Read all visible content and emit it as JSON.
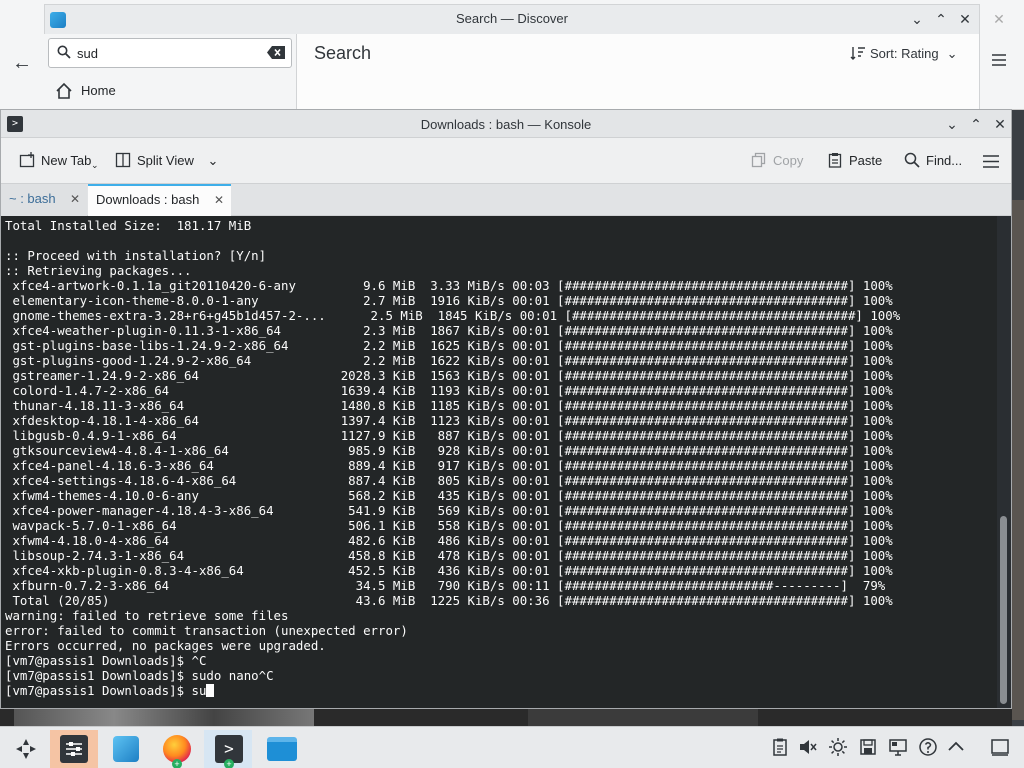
{
  "discover": {
    "title": "Search — Discover",
    "search_value": "sud",
    "home_label": "Home",
    "page_title": "Search",
    "sort_label": "Sort: Rating"
  },
  "konsole": {
    "title": "Downloads : bash — Konsole",
    "toolbar": {
      "new_tab": "New Tab",
      "split_view": "Split View",
      "copy": "Copy",
      "paste": "Paste",
      "find": "Find..."
    },
    "tabs": [
      {
        "label": "~ : bash",
        "active": false
      },
      {
        "label": "Downloads : bash",
        "active": true
      }
    ],
    "terminal_lines": [
      "Total Installed Size:  181.17 MiB",
      "",
      ":: Proceed with installation? [Y/n]",
      ":: Retrieving packages...",
      " xfce4-artwork-0.1.1a_git20110420-6-any         9.6 MiB  3.33 MiB/s 00:03 [######################################] 100%",
      " elementary-icon-theme-8.0.0-1-any              2.7 MiB  1916 KiB/s 00:01 [######################################] 100%",
      " gnome-themes-extra-3.28+r6+g45b1d457-2-...      2.5 MiB  1845 KiB/s 00:01 [######################################] 100%",
      " xfce4-weather-plugin-0.11.3-1-x86_64           2.3 MiB  1867 KiB/s 00:01 [######################################] 100%",
      " gst-plugins-base-libs-1.24.9-2-x86_64          2.2 MiB  1625 KiB/s 00:01 [######################################] 100%",
      " gst-plugins-good-1.24.9-2-x86_64               2.2 MiB  1622 KiB/s 00:01 [######################################] 100%",
      " gstreamer-1.24.9-2-x86_64                   2028.3 KiB  1563 KiB/s 00:01 [######################################] 100%",
      " colord-1.4.7-2-x86_64                       1639.4 KiB  1193 KiB/s 00:01 [######################################] 100%",
      " thunar-4.18.11-3-x86_64                     1480.8 KiB  1185 KiB/s 00:01 [######################################] 100%",
      " xfdesktop-4.18.1-4-x86_64                   1397.4 KiB  1123 KiB/s 00:01 [######################################] 100%",
      " libgusb-0.4.9-1-x86_64                      1127.9 KiB   887 KiB/s 00:01 [######################################] 100%",
      " gtksourceview4-4.8.4-1-x86_64                985.9 KiB   928 KiB/s 00:01 [######################################] 100%",
      " xfce4-panel-4.18.6-3-x86_64                  889.4 KiB   917 KiB/s 00:01 [######################################] 100%",
      " xfce4-settings-4.18.6-4-x86_64               887.4 KiB   805 KiB/s 00:01 [######################################] 100%",
      " xfwm4-themes-4.10.0-6-any                    568.2 KiB   435 KiB/s 00:01 [######################################] 100%",
      " xfce4-power-manager-4.18.4-3-x86_64          541.9 KiB   569 KiB/s 00:01 [######################################] 100%",
      " wavpack-5.7.0-1-x86_64                       506.1 KiB   558 KiB/s 00:01 [######################################] 100%",
      " xfwm4-4.18.0-4-x86_64                        482.6 KiB   486 KiB/s 00:01 [######################################] 100%",
      " libsoup-2.74.3-1-x86_64                      458.8 KiB   478 KiB/s 00:01 [######################################] 100%",
      " xfce4-xkb-plugin-0.8.3-4-x86_64              452.5 KiB   436 KiB/s 00:01 [######################################] 100%",
      " xfburn-0.7.2-3-x86_64                         34.5 MiB   790 KiB/s 00:11 [############################---------]  79%",
      " Total (20/85)                                 43.6 MiB  1225 KiB/s 00:36 [######################################] 100%",
      "warning: failed to retrieve some files",
      "error: failed to commit transaction (unexpected error)",
      "Errors occurred, no packages were upgraded.",
      "[vm7@passis1 Downloads]$ ^C",
      "[vm7@passis1 Downloads]$ sudo nano^C"
    ],
    "prompt_line": "[vm7@passis1 Downloads]$ su"
  },
  "taskbar": {
    "items": [
      "app-launcher",
      "system-settings",
      "discover",
      "firefox",
      "konsole",
      "dolphin"
    ],
    "tray_icons": [
      "clipboard-icon",
      "volume-muted-icon",
      "brightness-icon",
      "storage-icon",
      "display-icon",
      "help-icon",
      "expand-tray-icon",
      "show-desktop-icon"
    ]
  }
}
